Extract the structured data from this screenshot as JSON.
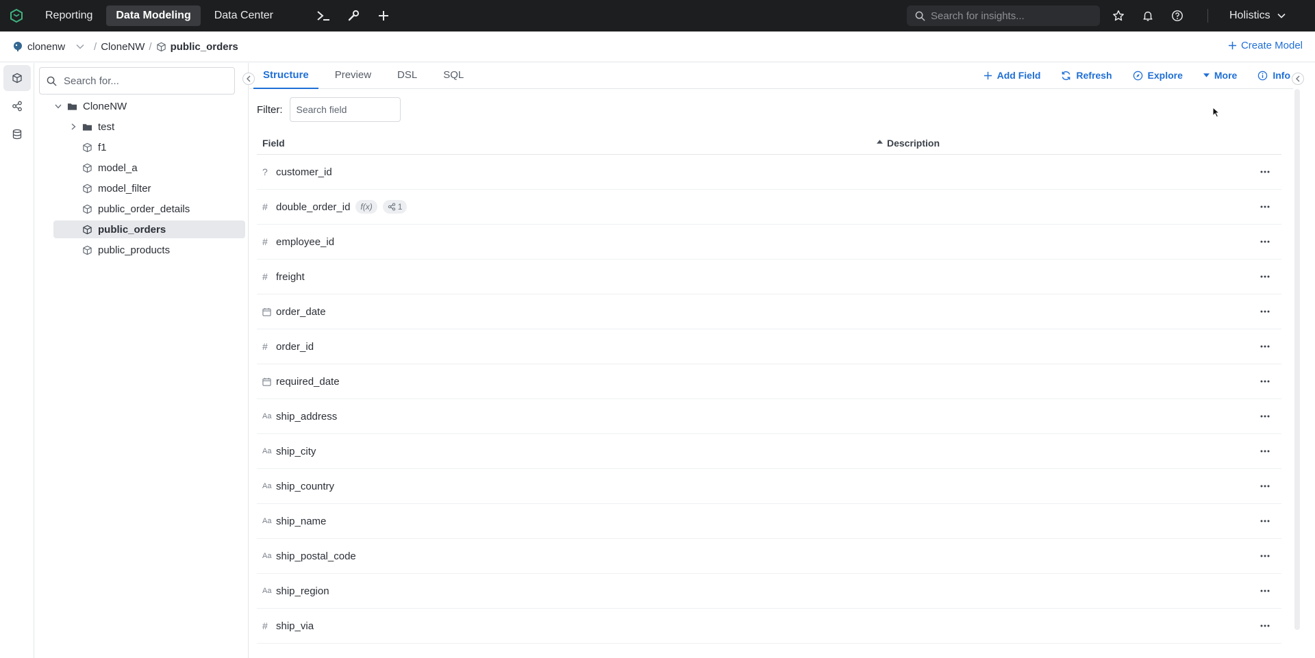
{
  "topbar": {
    "nav": [
      {
        "label": "Reporting",
        "active": false
      },
      {
        "label": "Data Modeling",
        "active": true
      },
      {
        "label": "Data Center",
        "active": false
      }
    ],
    "search_placeholder": "Search for insights...",
    "workspace": "Holistics"
  },
  "breadcrumb": {
    "datasource": "clonenw",
    "project": "CloneNW",
    "model": "public_orders",
    "create_label": "Create Model"
  },
  "tree": {
    "search_placeholder": "Search for...",
    "root": "CloneNW",
    "items": [
      {
        "label": "test",
        "type": "folder"
      },
      {
        "label": "f1",
        "type": "model"
      },
      {
        "label": "model_a",
        "type": "model"
      },
      {
        "label": "model_filter",
        "type": "model"
      },
      {
        "label": "public_order_details",
        "type": "model"
      },
      {
        "label": "public_orders",
        "type": "model",
        "selected": true
      },
      {
        "label": "public_products",
        "type": "model"
      }
    ]
  },
  "tabs": [
    "Structure",
    "Preview",
    "DSL",
    "SQL"
  ],
  "actions": {
    "add_field": "Add Field",
    "refresh": "Refresh",
    "explore": "Explore",
    "more": "More",
    "info": "Info"
  },
  "filter": {
    "label": "Filter:",
    "placeholder": "Search field"
  },
  "table": {
    "headers": {
      "field": "Field",
      "description": "Description"
    },
    "rows": [
      {
        "icon": "?",
        "name": "customer_id"
      },
      {
        "icon": "#",
        "name": "double_order_id",
        "chips": [
          "f(x)",
          "1"
        ]
      },
      {
        "icon": "#",
        "name": "employee_id"
      },
      {
        "icon": "#",
        "name": "freight"
      },
      {
        "icon": "cal",
        "name": "order_date"
      },
      {
        "icon": "#",
        "name": "order_id"
      },
      {
        "icon": "cal",
        "name": "required_date"
      },
      {
        "icon": "Aa",
        "name": "ship_address"
      },
      {
        "icon": "Aa",
        "name": "ship_city"
      },
      {
        "icon": "Aa",
        "name": "ship_country"
      },
      {
        "icon": "Aa",
        "name": "ship_name"
      },
      {
        "icon": "Aa",
        "name": "ship_postal_code"
      },
      {
        "icon": "Aa",
        "name": "ship_region"
      },
      {
        "icon": "#",
        "name": "ship_via"
      }
    ]
  },
  "colors": {
    "accent": "#1f6fd6",
    "topbar": "#1d1e20"
  }
}
